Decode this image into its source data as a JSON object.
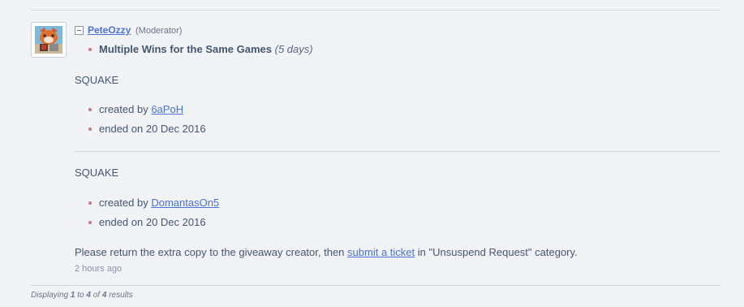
{
  "comment": {
    "username": "PeteOzzy",
    "role": "(Moderator)",
    "reason_title": "Multiple Wins for the Same Games",
    "reason_duration": "(5 days)",
    "giveaways": [
      {
        "game": "SQUAKE",
        "created_label": "created by",
        "creator": "6aPoH",
        "ended": "ended on 20 Dec 2016"
      },
      {
        "game": "SQUAKE",
        "created_label": "created by",
        "creator": "DomantasOn5",
        "ended": "ended on 20 Dec 2016"
      }
    ],
    "message_before": "Please return the extra copy to the giveaway creator, then",
    "message_link": "submit a ticket",
    "message_after": "in \"Unsuspend Request\" category.",
    "time": "2 hours ago"
  },
  "footer": {
    "prefix": "Displaying",
    "from": "1",
    "to_word": "to",
    "to": "4",
    "of_word": "of",
    "total": "4",
    "suffix": "results"
  },
  "icons": {
    "avatar": "avatar-image",
    "collapse": "collapse-icon"
  },
  "colors": {
    "link": "#4b72d4",
    "bullet": "#c87480",
    "text": "#465670",
    "background": "#f0f2f5"
  }
}
